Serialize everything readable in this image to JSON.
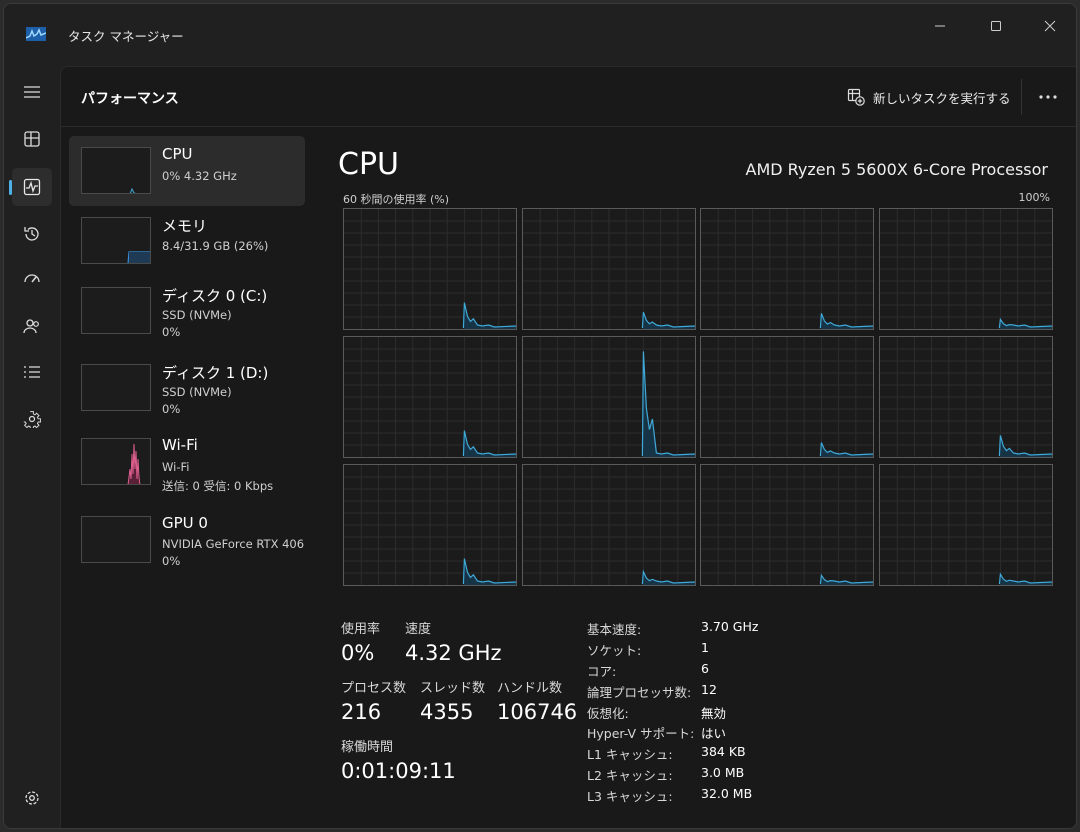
{
  "window": {
    "title": "タスク マネージャー"
  },
  "header": {
    "page_title": "パフォーマンス",
    "run_task_label": "新しいタスクを実行する"
  },
  "devices": [
    {
      "name": "CPU",
      "line1": "0%  4.32 GHz",
      "line2": ""
    },
    {
      "name": "メモリ",
      "line1": "8.4/31.9 GB (26%)",
      "line2": ""
    },
    {
      "name": "ディスク 0 (C:)",
      "line1": "SSD (NVMe)",
      "line2": "0%"
    },
    {
      "name": "ディスク 1 (D:)",
      "line1": "SSD (NVMe)",
      "line2": "0%"
    },
    {
      "name": "Wi-Fi",
      "line1": "Wi-Fi",
      "line2": "送信: 0 受信: 0 Kbps"
    },
    {
      "name": "GPU 0",
      "line1": "NVIDIA GeForce RTX 406",
      "line2": "0%"
    }
  ],
  "cpu": {
    "title": "CPU",
    "model": "AMD Ryzen 5 5600X 6-Core Processor",
    "graph_label": "60 秒間の使用率 (%)",
    "graph_max": "100%",
    "stats": {
      "usage_label": "使用率",
      "usage": "0%",
      "speed_label": "速度",
      "speed": "4.32 GHz",
      "processes_label": "プロセス数",
      "processes": "216",
      "threads_label": "スレッド数",
      "threads": "4355",
      "handles_label": "ハンドル数",
      "handles": "106746",
      "uptime_label": "稼働時間",
      "uptime": "0:01:09:11"
    },
    "specs": [
      {
        "key": "基本速度:",
        "value": "3.70 GHz"
      },
      {
        "key": "ソケット:",
        "value": "1"
      },
      {
        "key": "コア:",
        "value": "6"
      },
      {
        "key": "論理プロセッサ数:",
        "value": "12"
      },
      {
        "key": "仮想化:",
        "value": "無効"
      },
      {
        "key": "Hyper-V サポート:",
        "value": "はい"
      },
      {
        "key": "L1 キャッシュ:",
        "value": "384 KB"
      },
      {
        "key": "L2 キャッシュ:",
        "value": "3.0 MB"
      },
      {
        "key": "L3 キャッシュ:",
        "value": "32.0 MB"
      }
    ]
  },
  "colors": {
    "cpu_line": "#3fa9d8",
    "memory_line": "#3a8fd8",
    "wifi_line": "#e0608f",
    "accent": "#4fb0e6"
  },
  "icons": [
    "app-icon",
    "hamburger-icon",
    "processes-icon",
    "performance-icon",
    "app-history-icon",
    "startup-icon",
    "users-icon",
    "details-icon",
    "services-icon",
    "settings-icon",
    "run-task-icon",
    "more-icon",
    "minimize-icon",
    "maximize-icon",
    "close-icon"
  ]
}
